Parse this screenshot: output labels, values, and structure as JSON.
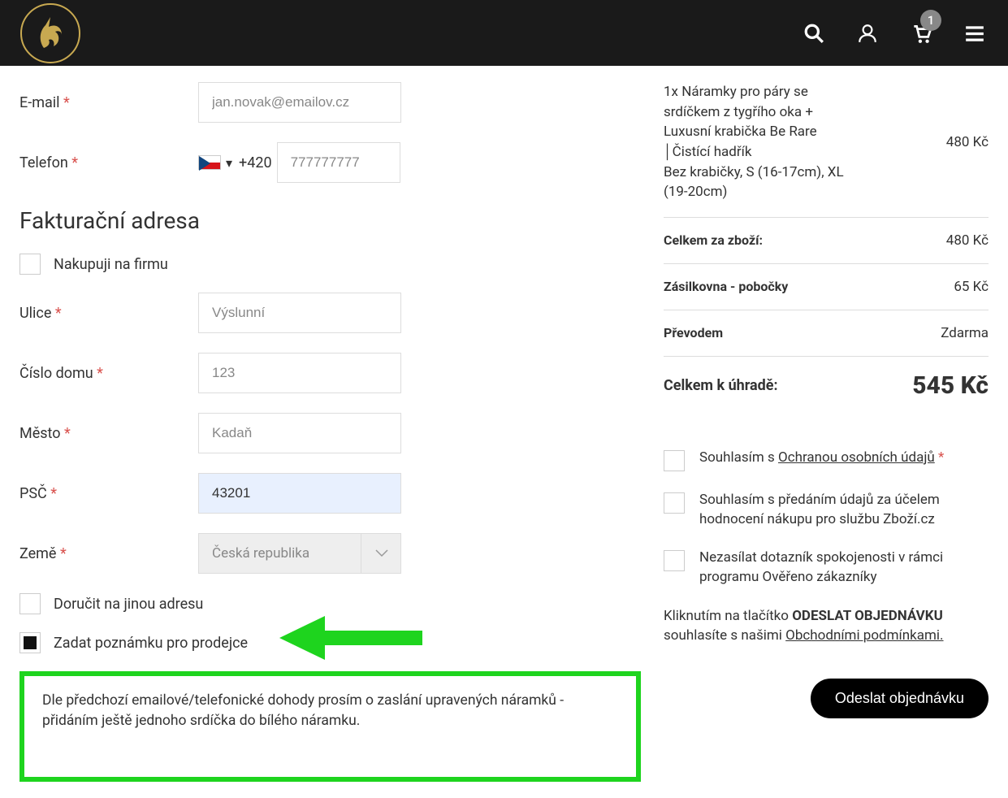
{
  "header": {
    "cart_badge": "1"
  },
  "form": {
    "email_label": "E-mail",
    "email_placeholder": "jan.novak@emailov.cz",
    "phone_label": "Telefon",
    "phone_prefix": "+420",
    "phone_placeholder": "777777777",
    "billing_title": "Fakturační adresa",
    "company_check": "Nakupuji na firmu",
    "street_label": "Ulice",
    "street_placeholder": "Výslunní",
    "houseno_label": "Číslo domu",
    "houseno_placeholder": "123",
    "city_label": "Město",
    "city_placeholder": "Kadaň",
    "zip_label": "PSČ",
    "zip_value": "43201",
    "country_label": "Země",
    "country_value": "Česká republika",
    "ship_other_check": "Doručit na jinou adresu",
    "note_check": "Zadat poznámku pro prodejce",
    "note_text": "Dle předchozí emailové/telefonické dohody prosím o zaslání upravených náramků - přidáním ještě jednoho srdíčka do bílého náramku."
  },
  "summary": {
    "item_name": "1x Náramky pro páry se srdíčkem z tygřího oka + Luxusní krabička Be Rare │Čistící hadřík",
    "item_variant": "Bez krabičky, S (16-17cm), XL (19-20cm)",
    "item_price": "480 Kč",
    "goods_label": "Celkem za zboží:",
    "goods_price": "480 Kč",
    "shipping_label": "Zásilkovna - pobočky",
    "shipping_price": "65 Kč",
    "payment_label": "Převodem",
    "payment_price": "Zdarma",
    "total_label": "Celkem k úhradě:",
    "total_price": "545 Kč"
  },
  "consents": {
    "privacy_pre": "Souhlasím s ",
    "privacy_link": "Ochranou osobních údajů",
    "zbozi": "Souhlasím s předáním údajů za účelem hodnocení nákupu pro službu Zboží.cz",
    "heureka": "Nezasílat dotazník spokojenosti v rámci programu Ověřeno zákazníky",
    "terms_pre": "Kliknutím na tlačítko ",
    "terms_bold": "ODESLAT OBJEDNÁVKU",
    "terms_mid": " souhlasíte s našimi ",
    "terms_link": "Obchodními podmínkami."
  },
  "submit_label": "Odeslat objednávku"
}
